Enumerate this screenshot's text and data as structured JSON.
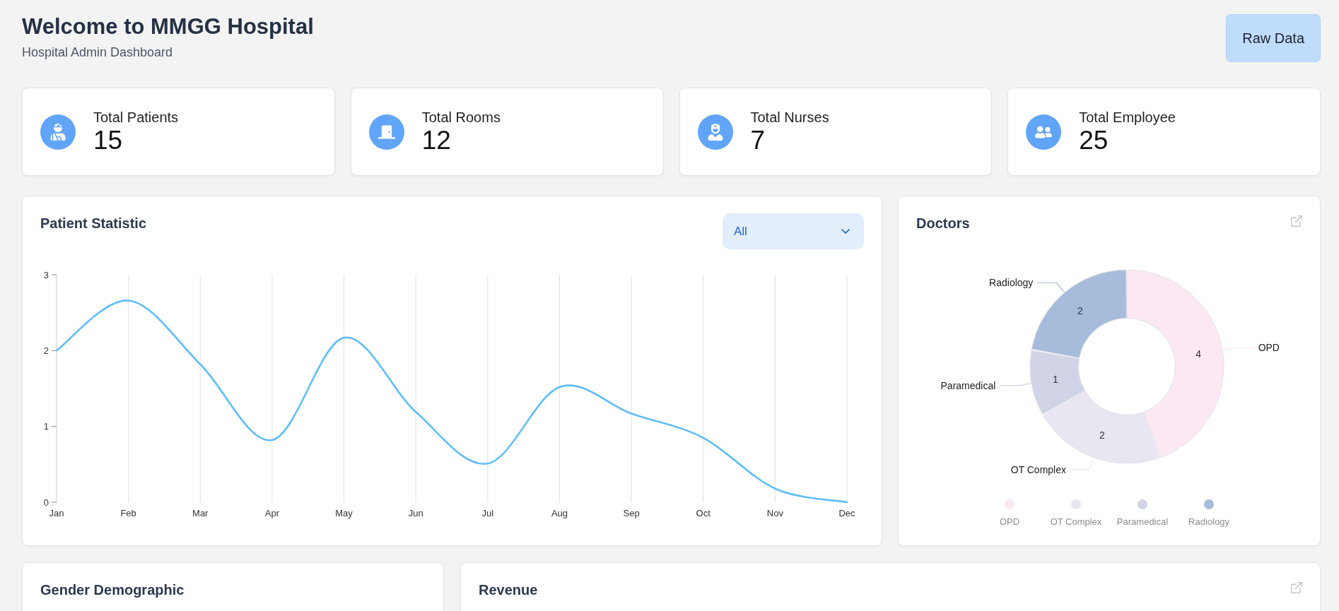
{
  "header": {
    "title": "Welcome to MMGG Hospital",
    "subtitle": "Hospital Admin Dashboard",
    "button": "Raw Data"
  },
  "stats": [
    {
      "label": "Total Patients",
      "value": "15"
    },
    {
      "label": "Total Rooms",
      "value": "12"
    },
    {
      "label": "Total Nurses",
      "value": "7"
    },
    {
      "label": "Total Employee",
      "value": "25"
    }
  ],
  "patient_statistic": {
    "title": "Patient Statistic",
    "filter": {
      "value": "All"
    },
    "chart_data": {
      "type": "line",
      "categories": [
        "Jan",
        "Feb",
        "Mar",
        "Apr",
        "May",
        "Jun",
        "Jul",
        "Aug",
        "Sep",
        "Oct",
        "Nov",
        "Dec"
      ],
      "series": [
        {
          "color": "#5ebdfc",
          "values": [
            2,
            2.66,
            1.82,
            0.82,
            2.17,
            1.19,
            0.51,
            1.52,
            1.17,
            0.85,
            0.18,
            0
          ]
        }
      ],
      "ylim": [
        0,
        3
      ],
      "yticks": [
        0,
        1,
        2,
        3
      ],
      "grid": true
    }
  },
  "doctors": {
    "title": "Doctors",
    "chart_data": {
      "type": "donut",
      "categories": [
        "OPD",
        "OT Complex",
        "Paramedical",
        "Radiology"
      ],
      "values": [
        4,
        2,
        1,
        2
      ],
      "data_labels": true
    },
    "legend": [
      {
        "label": "OPD",
        "color": "#fbe8f2"
      },
      {
        "label": "OT Complex",
        "color": "#e9e6f2"
      },
      {
        "label": "Paramedical",
        "color": "#d0d4e6"
      },
      {
        "label": "Radiology",
        "color": "#a7bcdb"
      }
    ]
  },
  "gender_demographic": {
    "title": "Gender Demographic"
  },
  "revenue": {
    "title": "Revenue"
  }
}
